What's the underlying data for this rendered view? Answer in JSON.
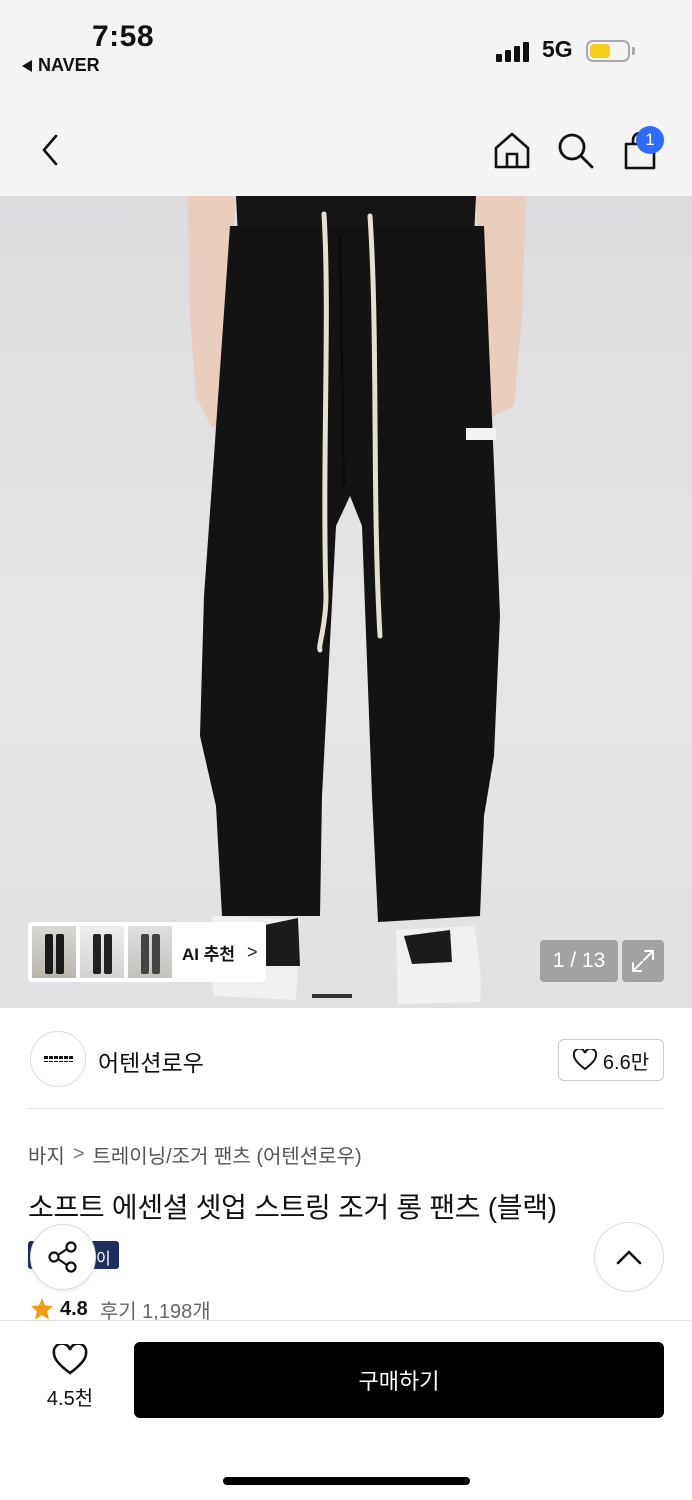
{
  "status_bar": {
    "time": "7:58",
    "back_app": "NAVER",
    "network": "5G",
    "battery_level_percent": 55,
    "battery_color": "#f5cc19"
  },
  "nav": {
    "icons": [
      "back-icon",
      "home-icon",
      "search-icon",
      "cart-icon"
    ],
    "cart_badge": "1",
    "badge_color": "#2f6bff"
  },
  "gallery": {
    "counter": "1 / 13",
    "ai_label": "AI 추천",
    "ai_chevron": ">"
  },
  "brand": {
    "name": "어텐션로우",
    "favorites": "6.6만"
  },
  "breadcrumb": {
    "category": "바지",
    "separator": ">",
    "subcategory": "트레이닝/조거 팬츠 (어텐션로우)"
  },
  "product": {
    "title": "소프트 에센셜 셋업 스트링 조거 롱 팬츠 (블랙)",
    "tag_fragment": "이",
    "tag_color": "#1e2f5e",
    "rating": "4.8",
    "reviews": "후기 1,198개"
  },
  "bottom_bar": {
    "like_count": "4.5천",
    "buy_label": "구매하기"
  }
}
